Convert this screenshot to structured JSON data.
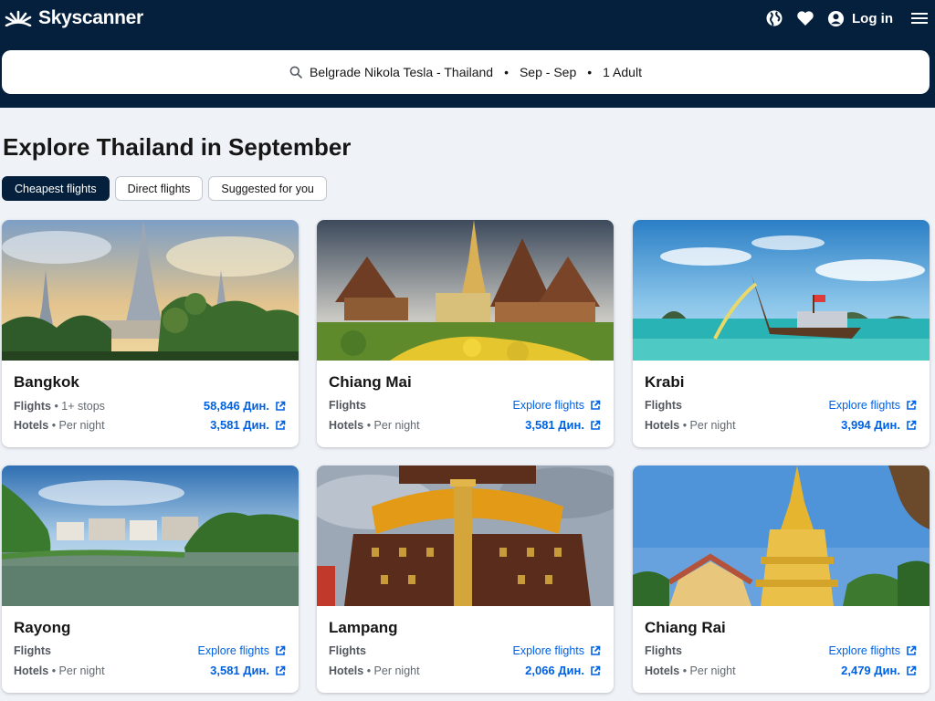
{
  "header": {
    "brand": "Skyscanner",
    "login_label": "Log in",
    "icons": [
      "sun-logo-icon",
      "globe-icon",
      "heart-icon",
      "user-icon",
      "menu-icon"
    ]
  },
  "search": {
    "route": "Belgrade Nikola Tesla - Thailand",
    "dates": "Sep - Sep",
    "travellers": "1 Adult",
    "separator": "•"
  },
  "page": {
    "title": "Explore Thailand in September"
  },
  "tabs": [
    {
      "label": "Cheapest flights",
      "active": true
    },
    {
      "label": "Direct flights",
      "active": false
    },
    {
      "label": "Suggested for you",
      "active": false
    }
  ],
  "cards": [
    {
      "city": "Bangkok",
      "flights_label": "Flights",
      "flights_note": "• 1+ stops",
      "flights_value": "58,846 Дин.",
      "hotels_label": "Hotels",
      "hotels_note": "• Per night",
      "hotels_value": "3,581 Дин."
    },
    {
      "city": "Chiang Mai",
      "flights_label": "Flights",
      "flights_note": "",
      "flights_value": "Explore flights",
      "hotels_label": "Hotels",
      "hotels_note": "• Per night",
      "hotels_value": "3,581 Дин."
    },
    {
      "city": "Krabi",
      "flights_label": "Flights",
      "flights_note": "",
      "flights_value": "Explore flights",
      "hotels_label": "Hotels",
      "hotels_note": "• Per night",
      "hotels_value": "3,994 Дин."
    },
    {
      "city": "Rayong",
      "flights_label": "Flights",
      "flights_note": "",
      "flights_value": "Explore flights",
      "hotels_label": "Hotels",
      "hotels_note": "• Per night",
      "hotels_value": "3,581 Дин."
    },
    {
      "city": "Lampang",
      "flights_label": "Flights",
      "flights_note": "",
      "flights_value": "Explore flights",
      "hotels_label": "Hotels",
      "hotels_note": "• Per night",
      "hotels_value": "2,066 Дин."
    },
    {
      "city": "Chiang Rai",
      "flights_label": "Flights",
      "flights_note": "",
      "flights_value": "Explore flights",
      "hotels_label": "Hotels",
      "hotels_note": "• Per night",
      "hotels_value": "2,479 Дин."
    }
  ],
  "colors": {
    "header_bg": "#05203c",
    "link_blue": "#0062e3",
    "page_bg": "#eff3f8"
  }
}
